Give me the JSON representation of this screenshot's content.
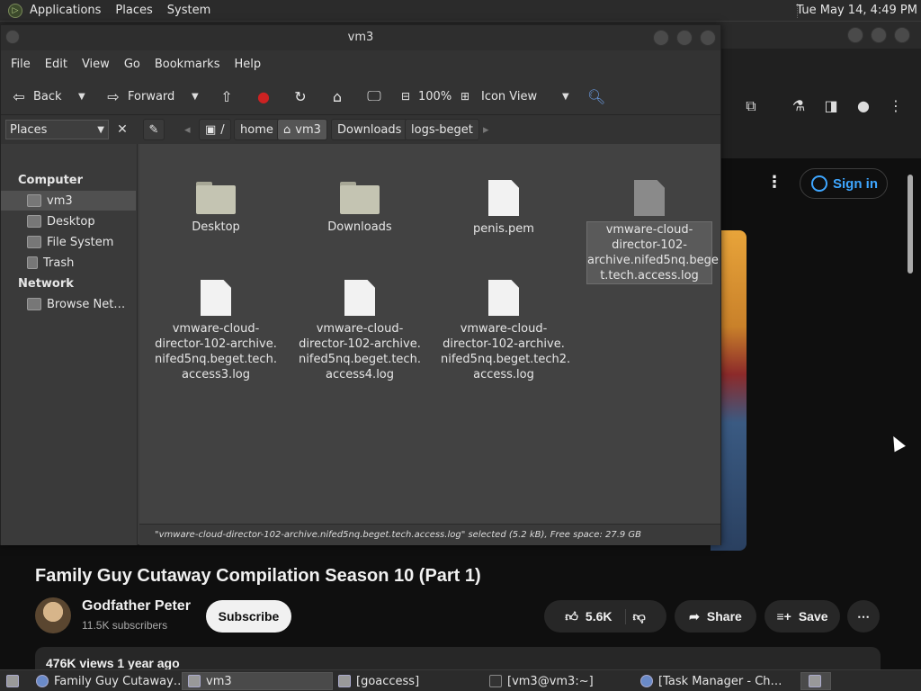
{
  "top_panel": {
    "menus": [
      "Applications",
      "Places",
      "System"
    ],
    "clock": "Tue May 14,  4:49 PM"
  },
  "browser": {
    "signin_label": "Sign in",
    "video_title": "Family Guy Cutaway Compilation Season 10 (Part 1)",
    "channel_name": "Godfather Peter",
    "subscribers": "11.5K subscribers",
    "subscribe_label": "Subscribe",
    "likes": "5.6K",
    "share_label": "Share",
    "save_label": "Save",
    "views_text": "476K views  1 year ago"
  },
  "file_manager": {
    "title": "vm3",
    "menus": [
      "File",
      "Edit",
      "View",
      "Go",
      "Bookmarks",
      "Help"
    ],
    "toolbar": {
      "back": "Back",
      "forward": "Forward",
      "zoom": "100%",
      "view_mode": "Icon View"
    },
    "places_select": "Places",
    "breadcrumbs": [
      "/",
      "home",
      "vm3",
      "Downloads",
      "logs-beget"
    ],
    "sidebar": {
      "computer_header": "Computer",
      "computer_items": [
        "vm3",
        "Desktop",
        "File System",
        "Trash"
      ],
      "network_header": "Network",
      "network_items": [
        "Browse Net…"
      ]
    },
    "files": [
      {
        "name": "Desktop",
        "type": "folder"
      },
      {
        "name": "Downloads",
        "type": "folder"
      },
      {
        "name": "penis.pem",
        "type": "document"
      },
      {
        "name": "vmware-cloud-director-102-archive.nifed5nq.beget.tech.access.log",
        "type": "document",
        "selected": true
      },
      {
        "name": "vmware-cloud-director-102-archive.nifed5nq.beget.tech.access3.log",
        "type": "document"
      },
      {
        "name": "vmware-cloud-director-102-archive.nifed5nq.beget.tech.access4.log",
        "type": "document"
      },
      {
        "name": "vmware-cloud-director-102-archive.nifed5nq.beget.tech2.access.log",
        "type": "document"
      }
    ],
    "file_labels": {
      "f0": "Desktop",
      "f1": "Downloads",
      "f2": "penis.pem",
      "f3": "vmware-cloud-director-102-archive.nifed5nq.bege t.tech.access.log",
      "f4": "vmware-cloud-director-102-archive. nifed5nq.beget.tech. access3.log",
      "f5": "vmware-cloud-director-102-archive. nifed5nq.beget.tech. access4.log",
      "f6": "vmware-cloud-director-102-archive. nifed5nq.beget.tech2. access.log"
    },
    "status": "\"vmware-cloud-director-102-archive.nifed5nq.beget.tech.access.log\" selected (5.2 kB), Free space: 27.9 GB"
  },
  "taskbar": {
    "items": [
      "Family Guy Cutaway…",
      "vm3",
      "[goaccess]",
      "[vm3@vm3:~]",
      "[Task Manager - Ch…"
    ]
  },
  "colors": {
    "yt_accent": "#3ea6ff",
    "panel_bg": "#2b2b2b",
    "fm_content_bg": "#424242"
  }
}
